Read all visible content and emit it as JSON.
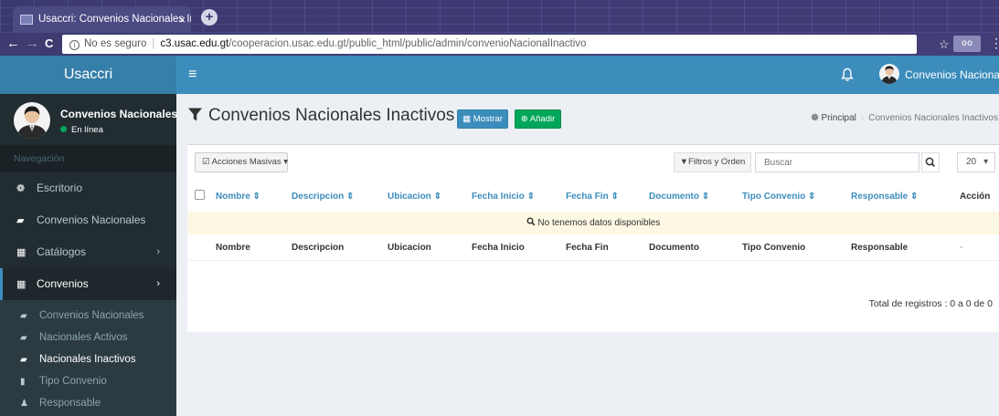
{
  "browser": {
    "tab_title": "Usaccri: Convenios Nacionales In",
    "tab_close": "×",
    "new_tab": "+",
    "back": "←",
    "forward": "→",
    "reload": "C",
    "security_label": "No es seguro",
    "url_host": "c3.usac.edu.gt",
    "url_path": "/cooperacion.usac.edu.gt/public_html/public/admin/convenioNacionalInactivo",
    "bookmark_star": "☆",
    "more_menu": "⋮"
  },
  "header": {
    "brand": "Usaccri",
    "menu_toggle": "≡",
    "user_name": "Convenios Nacionales"
  },
  "sidebar": {
    "user_name": "Convenios Nacionales",
    "user_status": "En línea",
    "nav_header": "Navegación",
    "menu": [
      {
        "label": "Escritorio",
        "icon": "dashboard-icon"
      },
      {
        "label": "Convenios Nacionales",
        "icon": "book-icon"
      },
      {
        "label": "Catálogos",
        "icon": "table-icon",
        "chevron": "›"
      },
      {
        "label": "Convenios",
        "icon": "table-icon",
        "chevron": "›"
      }
    ],
    "submenu": [
      {
        "label": "Convenios Nacionales",
        "icon": "book-icon"
      },
      {
        "label": "Nacionales Activos",
        "icon": "book-icon"
      },
      {
        "label": "Nacionales Inactivos",
        "icon": "book-icon"
      },
      {
        "label": "Tipo Convenio",
        "icon": "bookmark-icon"
      },
      {
        "label": "Responsable",
        "icon": "user-icon"
      }
    ]
  },
  "content": {
    "title": "Convenios Nacionales Inactivos",
    "btn_mostrar": "Mostrar",
    "btn_anadir": "Añadir",
    "breadcrumb_home": "Principal",
    "breadcrumb_current": "Convenios Nacionales Inactivos"
  },
  "toolbar": {
    "acciones_label": "Acciones Masivas",
    "filtros_label": "Filtros y Orden",
    "search_placeholder": "Buscar",
    "per_page": "20"
  },
  "table": {
    "columns": [
      "Nombre ⇕",
      "Descripcion ⇕",
      "Ubicacion ⇕",
      "Fecha Inicio ⇕",
      "Fecha Fin ⇕",
      "Documento ⇕",
      "Tipo Convenio ⇕",
      "Responsable ⇕",
      "Acción"
    ],
    "footer": [
      "Nombre",
      "Descripcion",
      "Ubicacion",
      "Fecha Inicio",
      "Fecha Fin",
      "Documento",
      "Tipo Convenio",
      "Responsable",
      "-"
    ],
    "empty_message": "No tenemos datos disponibles",
    "total_label": "Total de registros : 0 a 0 de 0"
  },
  "colors": {
    "primary": "#3c8dbc",
    "sidebar_bg": "#222d32",
    "success": "#00a65a",
    "warning_row": "#fcf8e3"
  }
}
